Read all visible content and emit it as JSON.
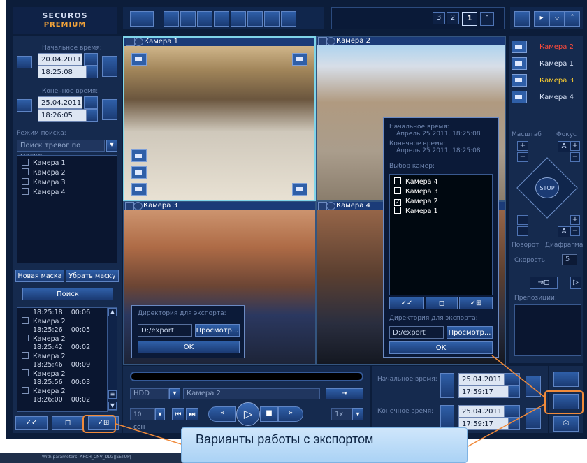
{
  "logo": {
    "line1": "SECUROS",
    "line2": "PREMIUM"
  },
  "pages": [
    "3",
    "2",
    "1"
  ],
  "left": {
    "start_label": "Начальное время:",
    "start_date": "20.04.2011",
    "start_time": "18:25:08",
    "end_label": "Конечное время:",
    "end_date": "25.04.2011",
    "end_time": "18:26:05",
    "mode_label": "Режим поиска:",
    "mode_value": "Поиск тревог по маске",
    "cameras": [
      "Камера 1",
      "Камера 2",
      "Камера 3",
      "Камера 4"
    ],
    "new_mask": "Новая маска",
    "remove_mask": "Убрать маску",
    "search": "Поиск",
    "results": [
      {
        "cam": "",
        "time": "18:25:18",
        "dur": "00:06"
      },
      {
        "cam": "Камера 2",
        "time": "18:25:26",
        "dur": "00:05"
      },
      {
        "cam": "Камера 2",
        "time": "18:25:42",
        "dur": "00:02"
      },
      {
        "cam": "Камера 2",
        "time": "18:25:46",
        "dur": "00:09"
      },
      {
        "cam": "Камера 2",
        "time": "18:25:56",
        "dur": "00:03"
      },
      {
        "cam": "Камера 2",
        "time": "18:26:00",
        "dur": "00:02"
      }
    ]
  },
  "cams": {
    "c1": "Камера 1",
    "c2": "Камера 2",
    "c3": "Камера 3",
    "c4": "Камера 4"
  },
  "export_small": {
    "label": "Директория для экспорта:",
    "path": "D:/export",
    "browse": "Просмотр...",
    "ok": "OK"
  },
  "export_popup": {
    "start_label": "Начальное время:",
    "start_value": "Апрель 25 2011, 18:25:08",
    "end_label": "Конечное время:",
    "end_value": "Апрель 25 2011, 18:25:08",
    "select_label": "Выбор камер:",
    "cameras": [
      "Камера 4",
      "Камера 3",
      "Камера 2",
      "Камера 1"
    ],
    "dir_label": "Директория для экспорта:",
    "path": "D:/export",
    "browse": "Просмотр...",
    "ok": "OK"
  },
  "right": {
    "cameras": [
      {
        "name": "Камера 2",
        "color": "#ff4b3b"
      },
      {
        "name": "Камера 1",
        "color": "#d7e1f5"
      },
      {
        "name": "Камера 3",
        "color": "#ffd02f"
      },
      {
        "name": "Камера 4",
        "color": "#d7e1f5"
      }
    ],
    "scale": "Масштаб",
    "focus": "Фокус",
    "stop": "STOP",
    "rotate": "Поворот",
    "iris": "Диафрагма",
    "speed_label": "Скорость:",
    "speed_value": "5",
    "presets": "Препозиции:"
  },
  "bottom": {
    "source": "HDD",
    "camera": "Камера 2",
    "date_sel": "10 сен",
    "speed": "1x",
    "start_label": "Начальное время:",
    "start_date": "25.04.2011",
    "start_time": "17:59:17",
    "end_label": "Конечное время:",
    "end_date": "25.04.2011",
    "end_time": "17:59:17"
  },
  "callout": "Варианты работы с экспортом",
  "status": "With parameters: ARCH_CNV_DLG||SETUP|"
}
